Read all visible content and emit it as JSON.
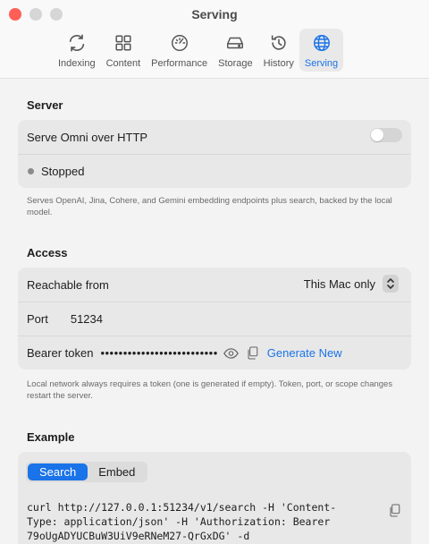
{
  "window": {
    "title": "Serving"
  },
  "toolbar": {
    "tabs": [
      {
        "label": "Indexing",
        "icon": "arrows-cycle-icon"
      },
      {
        "label": "Content",
        "icon": "grid-icon"
      },
      {
        "label": "Performance",
        "icon": "gauge-icon"
      },
      {
        "label": "Storage",
        "icon": "drive-icon"
      },
      {
        "label": "History",
        "icon": "clock-history-icon"
      },
      {
        "label": "Serving",
        "icon": "globe-icon",
        "active": true
      }
    ]
  },
  "server": {
    "title": "Server",
    "http_label": "Serve Omni over HTTP",
    "http_enabled": false,
    "status": "Stopped",
    "note": "Serves OpenAI, Jina, Cohere, and Gemini embedding endpoints plus search, backed by the local model."
  },
  "access": {
    "title": "Access",
    "reachable_label": "Reachable from",
    "reachable_value": "This Mac only",
    "port_label": "Port",
    "port_value": "51234",
    "token_label": "Bearer token",
    "token_masked": "••••••••••••••••••••••••••",
    "generate_label": "Generate New",
    "note": "Local network always requires a token (one is generated if empty). Token, port, or scope changes restart the server."
  },
  "example": {
    "title": "Example",
    "tabs": [
      "Search",
      "Embed"
    ],
    "selected_tab": "Search",
    "code_lines": [
      "curl http://127.0.0.1:51234/v1/search -H 'Content-",
      "Type: application/json' -H 'Authorization: Bearer",
      "79oUgADYUCBuW3UiV9eRNeM27-QrGxDG' -d"
    ]
  },
  "colors": {
    "accent": "#1a73e8",
    "close": "#ff5f57"
  }
}
